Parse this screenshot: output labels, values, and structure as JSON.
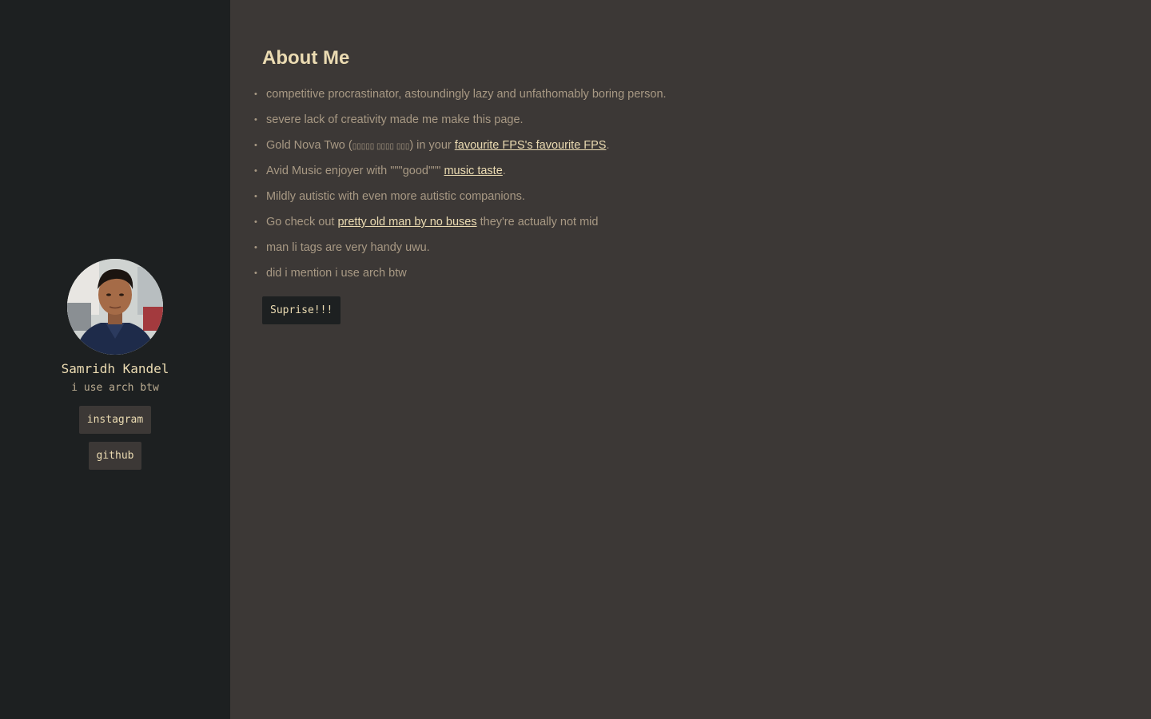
{
  "sidebar": {
    "name": "Samridh Kandel",
    "tagline": "i use arch btw",
    "buttons": {
      "instagram": "instagram",
      "github": "github"
    }
  },
  "main": {
    "title": "About Me",
    "items": [
      {
        "text": "competitive procrastinator, astoundingly lazy and unfathomably boring person."
      },
      {
        "text": "severe lack of creativity made me make this page."
      },
      {
        "before": "Gold Nova Two (",
        "glyphs": "▯▯▯▯▯ ▯▯▯▯ ▯▯▯",
        "mid": ") in your ",
        "link": "favourite FPS's favourite FPS",
        "after": "."
      },
      {
        "before": "Avid Music enjoyer with \"\"\"good\"\"\" ",
        "link": "music taste",
        "after": "."
      },
      {
        "text": "Mildly autistic with even more autistic companions."
      },
      {
        "before": "Go check out ",
        "link": "pretty old man by no buses",
        "after": " they're actually not mid"
      },
      {
        "text": "man li tags are very handy uwu."
      },
      {
        "text": "did i mention i use arch btw"
      }
    ],
    "surprise_button": "Suprise!!!"
  },
  "colors": {
    "sidebar_bg": "#1d2021",
    "main_bg": "#3c3836",
    "heading": "#ebdbb2",
    "body_text": "#a89984",
    "link": "#ebdbb2"
  },
  "icons": {
    "bullet": "bullet-dot-icon"
  }
}
